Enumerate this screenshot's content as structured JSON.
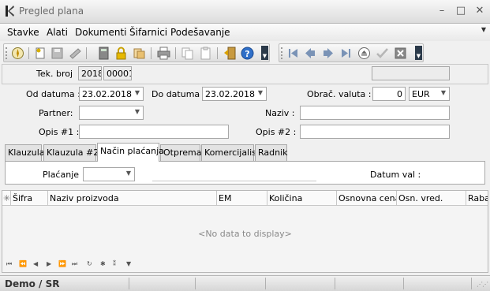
{
  "window": {
    "title": "Pregled plana",
    "minimize": "–",
    "maximize": "□",
    "close": "✕"
  },
  "menu": {
    "items": [
      "Stavke",
      "Alati",
      "Dokumenti",
      "Šifarnici",
      "Podešavanje"
    ],
    "more": "▼"
  },
  "toolbar_left": {
    "icons": [
      "compass-icon",
      "new-document-icon",
      "save-disk-icon",
      "approve-icon",
      "calculator-icon",
      "lock-icon",
      "copy-icon",
      "print-icon",
      "duplicate-icon",
      "paste-icon",
      "exit-door-icon",
      "help-icon"
    ]
  },
  "toolbar_right": {
    "icons": [
      "first-record-icon",
      "previous-record-icon",
      "next-record-icon",
      "last-record-icon",
      "eject-icon",
      "check-icon",
      "cancel-icon"
    ]
  },
  "header": {
    "tek_broj_label": "Tek. broj",
    "tek_broj_year": "2018",
    "tek_broj_number": "00001",
    "extra_value": ""
  },
  "form": {
    "od_datuma_label": "Od datuma :",
    "od_datuma_value": "23.02.2018",
    "do_datuma_label": "Do datuma :",
    "do_datuma_value": "23.02.2018",
    "valuta_label": "Obrač. valuta :",
    "valuta_amount": "0",
    "valuta_currency": "EUR",
    "partner_label": "Partner:",
    "partner_value": "",
    "naziv_label": "Naziv :",
    "naziv_value": "",
    "opis1_label": "Opis #1 :",
    "opis1_value": "",
    "opis2_label": "Opis #2 :",
    "opis2_value": ""
  },
  "tabs": [
    "Klauzula",
    "Klauzula #2",
    "Način plaćanja",
    "Otprema",
    "Komercijalist",
    "Radnik"
  ],
  "active_tab": "Način plaćanja",
  "payment": {
    "placanje_label": "Plaćanje",
    "placanje_value": "",
    "datum_val_label": "Datum val :"
  },
  "grid": {
    "columns": [
      "Šifra",
      "Naziv proizvoda",
      "EM",
      "Količina",
      "Osnovna cena",
      "Osn. vred.",
      "Rabat"
    ],
    "empty_text": "<No data to display>",
    "row_marker": "✳"
  },
  "status": {
    "text": "Demo / SR"
  }
}
